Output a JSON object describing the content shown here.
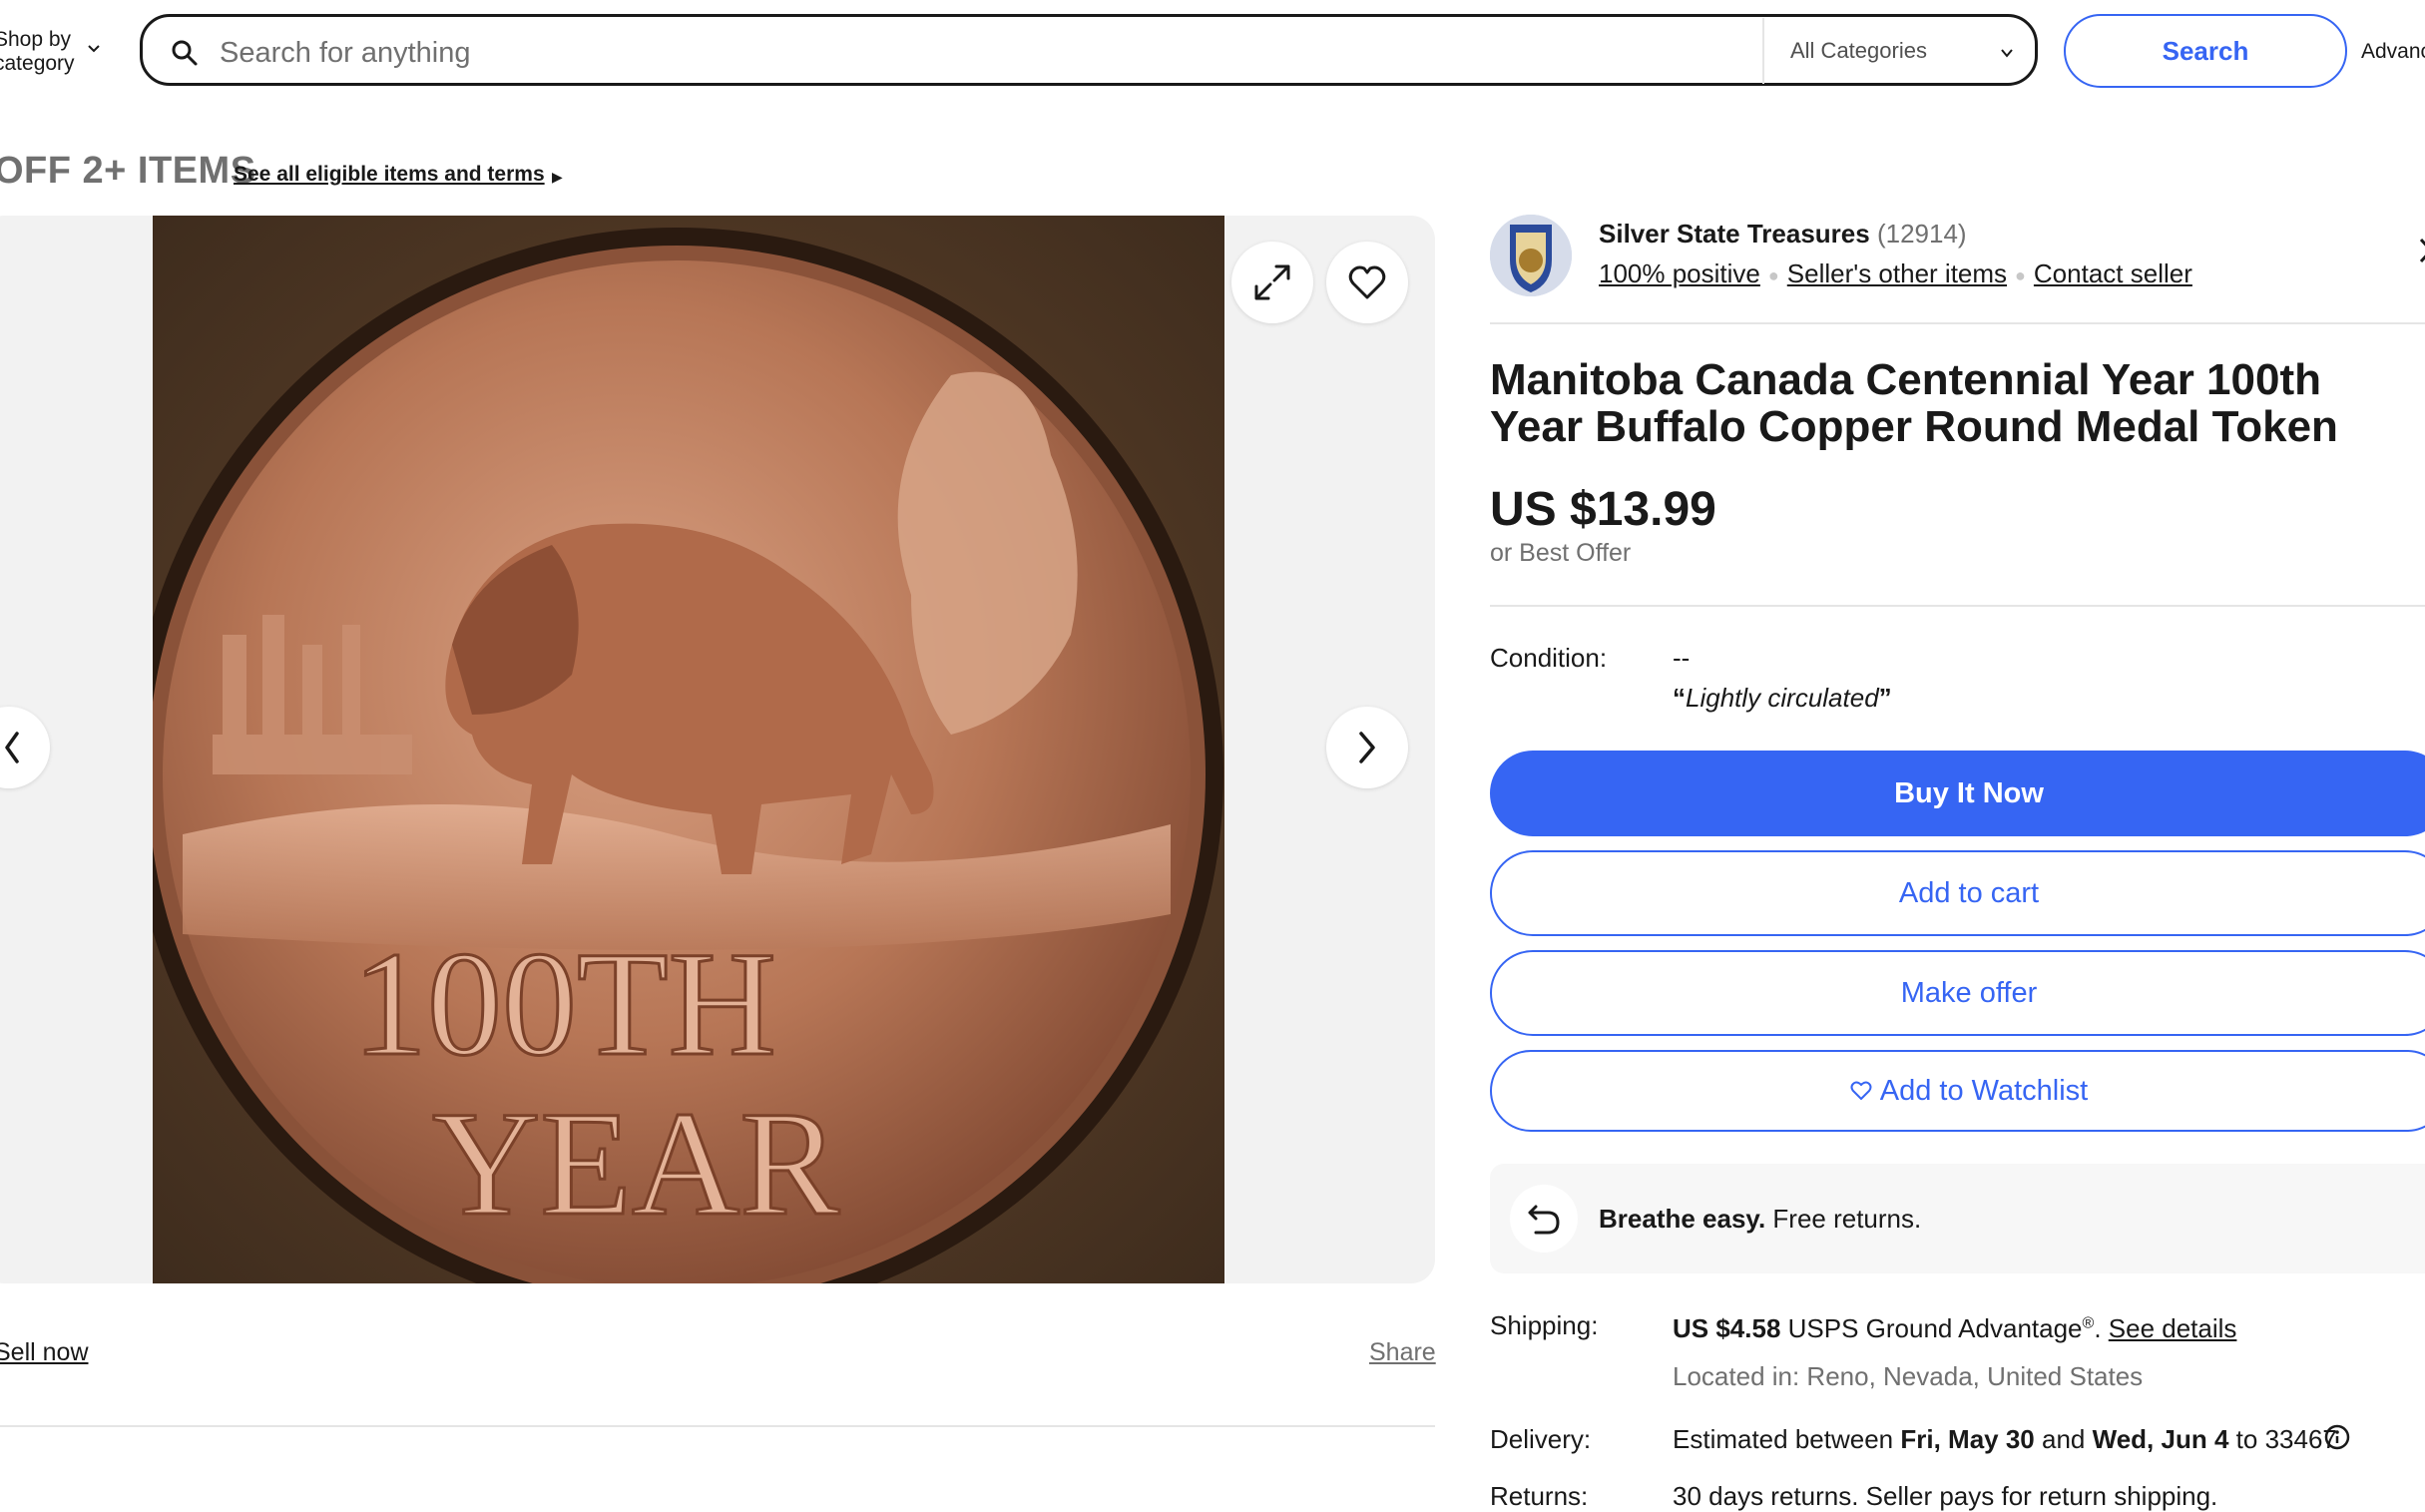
{
  "header": {
    "shop_by_category": "Shop by category",
    "search_placeholder": "Search for anything",
    "category_selected": "All Categories",
    "search_button": "Search",
    "advanced": "Advanced"
  },
  "promo": {
    "title": "OFF 2+ ITEMS",
    "link": "See all eligible items and terms"
  },
  "gallery": {
    "image_description": "Copper medal with buffalo and 100TH YEAR",
    "medal_text_top": "100TH",
    "medal_text_bottom": "YEAR",
    "sell_now": "Sell now",
    "share": "Share"
  },
  "seller": {
    "name": "Silver State Treasures",
    "feedback_count": "(12914)",
    "positive": "100% positive",
    "other_items": "Seller's other items",
    "contact": "Contact seller"
  },
  "listing": {
    "title": "Manitoba Canada Centennial Year 100th Year Buffalo Copper Round Medal Token",
    "price": "US $13.99",
    "best_offer": "or Best Offer",
    "condition_label": "Condition:",
    "condition_value": "--",
    "condition_note": "Lightly circulated"
  },
  "actions": {
    "buy_now": "Buy It Now",
    "add_to_cart": "Add to cart",
    "make_offer": "Make offer",
    "add_to_watchlist": "Add to Watchlist"
  },
  "returns_banner": {
    "bold": "Breathe easy.",
    "text": "Free returns."
  },
  "shipping": {
    "label": "Shipping:",
    "cost": "US $4.58",
    "service": "USPS Ground Advantage",
    "see_details": "See details",
    "located": "Located in: Reno, Nevada, United States"
  },
  "delivery": {
    "label": "Delivery:",
    "prefix": "Estimated between",
    "date_from": "Fri, May 30",
    "and": "and",
    "date_to": "Wed, Jun 4",
    "to_zip": "to 33467"
  },
  "returns": {
    "label": "Returns:",
    "text": "30 days returns. Seller pays for return shipping."
  },
  "colors": {
    "accent": "#3665f3",
    "text": "#191919",
    "muted": "#707070"
  }
}
